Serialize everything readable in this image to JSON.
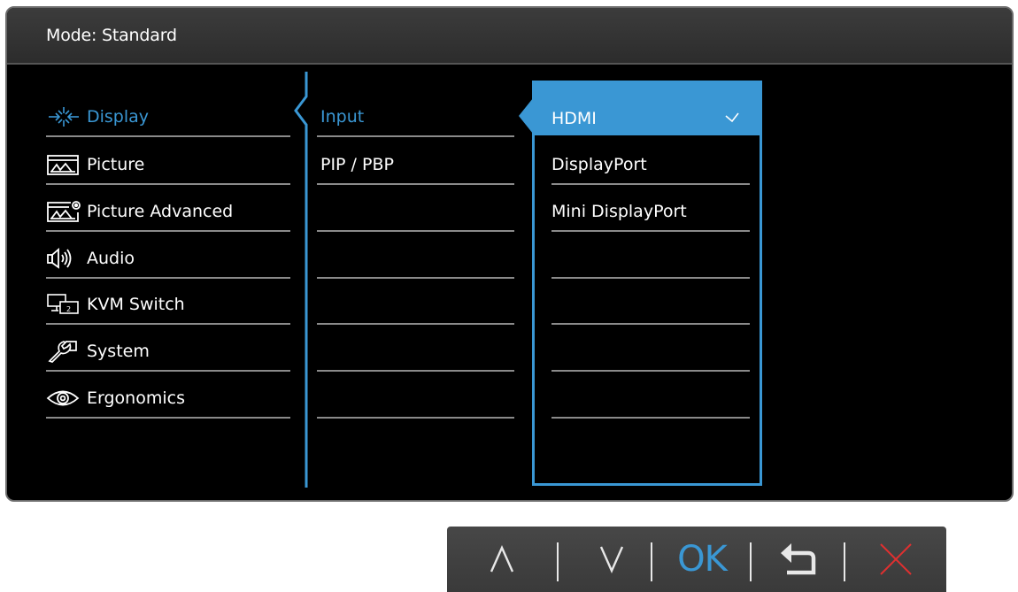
{
  "header": {
    "mode_label": "Mode: Standard"
  },
  "main_menu": {
    "items": [
      {
        "label": "Display",
        "icon": "display-icon",
        "active": true
      },
      {
        "label": "Picture",
        "icon": "picture-icon",
        "active": false
      },
      {
        "label": "Picture Advanced",
        "icon": "picture-advanced-icon",
        "active": false
      },
      {
        "label": "Audio",
        "icon": "audio-icon",
        "active": false
      },
      {
        "label": "KVM Switch",
        "icon": "kvm-switch-icon",
        "active": false
      },
      {
        "label": "System",
        "icon": "wrench-icon",
        "active": false
      },
      {
        "label": "Ergonomics",
        "icon": "eye-icon",
        "active": false
      }
    ]
  },
  "sub_menu": {
    "items": [
      {
        "label": "Input",
        "active": true
      },
      {
        "label": "PIP / PBP",
        "active": false
      }
    ]
  },
  "input_options": {
    "selected": "HDMI",
    "items": [
      {
        "label": "DisplayPort"
      },
      {
        "label": "Mini DisplayPort"
      }
    ]
  },
  "control_keys": {
    "up": "up-arrow-icon",
    "down": "down-arrow-icon",
    "ok": "OK",
    "back": "back-icon",
    "exit": "close-icon"
  },
  "colors": {
    "accent": "#3a97d4",
    "background": "#000000",
    "header": "#333333",
    "exit": "#e03030"
  }
}
